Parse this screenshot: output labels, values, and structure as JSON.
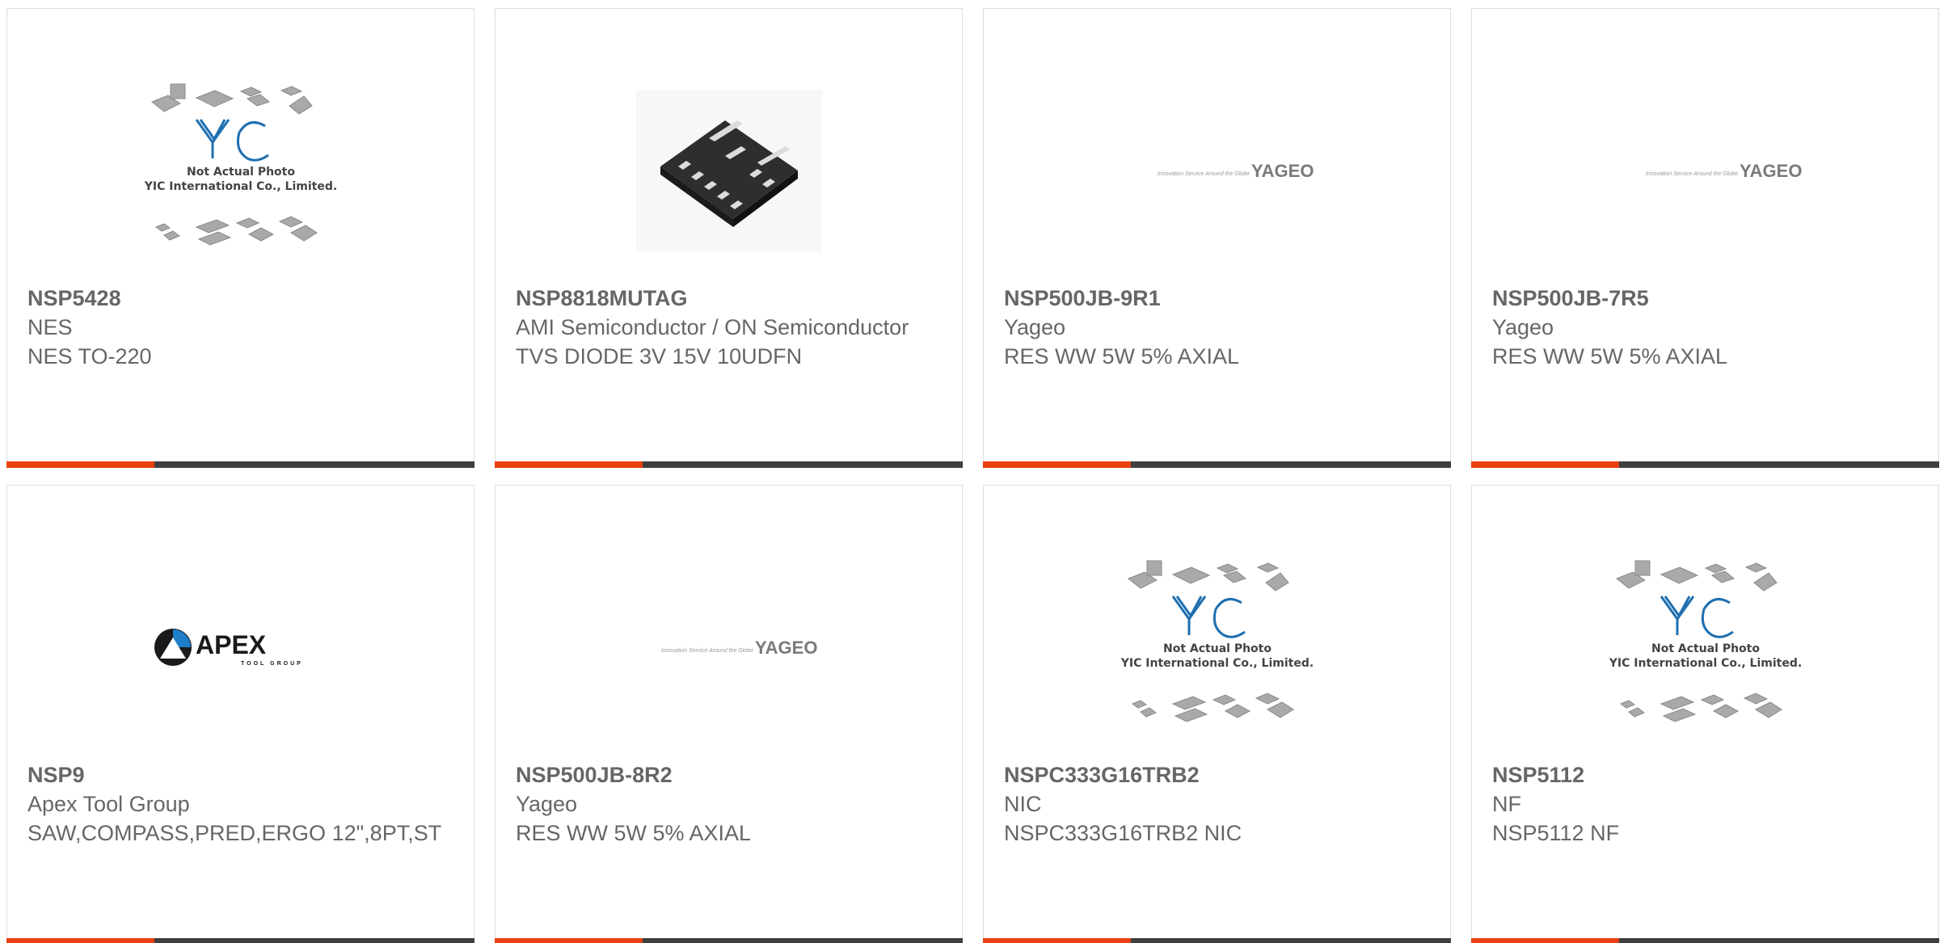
{
  "colors": {
    "accent_orange": "#e8410f",
    "bar_dark": "#3f3f3f",
    "text_gray": "#666666",
    "border": "#dcdcdc"
  },
  "products": [
    {
      "part_number": "NSP5428",
      "manufacturer": "NES",
      "description": "NES TO-220",
      "image": "yic-placeholder",
      "image_text_1": "Not Actual Photo",
      "image_text_2": "YIC International Co., Limited."
    },
    {
      "part_number": "NSP8818MUTAG",
      "manufacturer": "AMI Semiconductor / ON Semiconductor",
      "description": "TVS DIODE 3V 15V 10UDFN",
      "image": "udfn-chip-photo"
    },
    {
      "part_number": "NSP500JB-9R1",
      "manufacturer": "Yageo",
      "description": "RES WW 5W 5% AXIAL",
      "image": "yageo-logo",
      "logo_tagline": "Innovation Service Around the Globe",
      "logo_text": "YAGEO"
    },
    {
      "part_number": "NSP500JB-7R5",
      "manufacturer": "Yageo",
      "description": "RES WW 5W 5% AXIAL",
      "image": "yageo-logo",
      "logo_tagline": "Innovation Service Around the Globe",
      "logo_text": "YAGEO"
    },
    {
      "part_number": "NSP9",
      "manufacturer": "Apex Tool Group",
      "description": "SAW,COMPASS,PRED,ERGO 12\",8PT,ST",
      "image": "apex-logo",
      "logo_text": "APEX",
      "logo_subtext": "TOOL GROUP"
    },
    {
      "part_number": "NSP500JB-8R2",
      "manufacturer": "Yageo",
      "description": "RES WW 5W 5% AXIAL",
      "image": "yageo-logo",
      "logo_tagline": "Innovation Service Around the Globe",
      "logo_text": "YAGEO"
    },
    {
      "part_number": "NSPC333G16TRB2",
      "manufacturer": "NIC",
      "description": "NSPC333G16TRB2 NIC",
      "image": "yic-placeholder",
      "image_text_1": "Not Actual Photo",
      "image_text_2": "YIC International Co., Limited."
    },
    {
      "part_number": "NSP5112",
      "manufacturer": "NF",
      "description": "NSP5112 NF",
      "image": "yic-placeholder",
      "image_text_1": "Not Actual Photo",
      "image_text_2": "YIC International Co., Limited."
    }
  ]
}
